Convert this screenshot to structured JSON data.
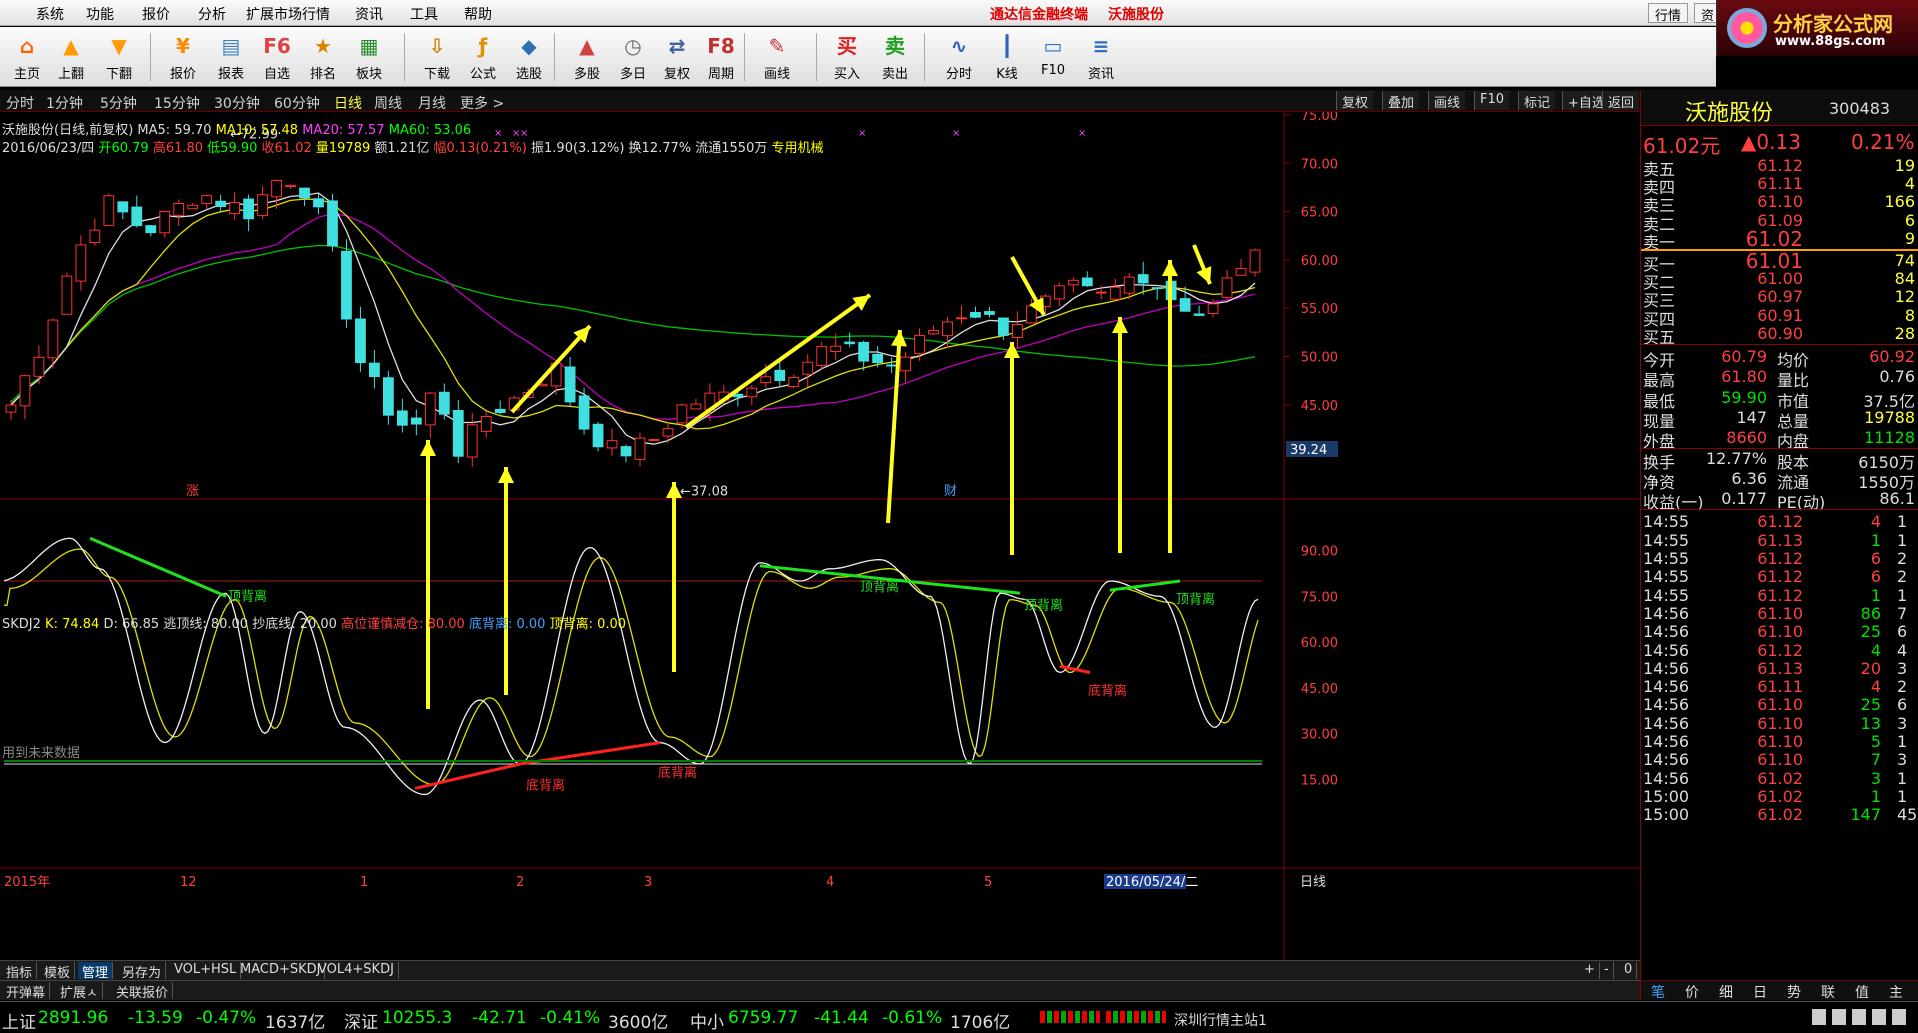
{
  "menu": {
    "items": [
      "系统",
      "功能",
      "报价",
      "分析",
      "扩展市场行情",
      "资讯",
      "工具",
      "帮助"
    ],
    "center_title": "通达信金融终端",
    "center_stock": "沃施股份",
    "right_btns": [
      "行情",
      "资"
    ]
  },
  "logo": {
    "line1": "分析家公式网",
    "line2": "www.88gs.com"
  },
  "toolbar": [
    {
      "label": "主页",
      "icon": "home-icon",
      "color": "#ff6000",
      "glyph": "⌂"
    },
    {
      "label": "上翻",
      "icon": "arrow-up-icon",
      "color": "#ff9a00",
      "glyph": "▲"
    },
    {
      "label": "下翻",
      "icon": "arrow-down-icon",
      "color": "#ff9a00",
      "glyph": "▼"
    },
    {
      "label": "报价",
      "icon": "quote-icon",
      "color": "#ff8800",
      "glyph": "¥"
    },
    {
      "label": "报表",
      "icon": "report-icon",
      "color": "#4080c0",
      "glyph": "▤"
    },
    {
      "label": "自选",
      "icon": "watchlist-icon",
      "color": "#e04040",
      "glyph": "F6"
    },
    {
      "label": "排名",
      "icon": "rank-icon",
      "color": "#e08000",
      "glyph": "★"
    },
    {
      "label": "板块",
      "icon": "sector-icon",
      "color": "#2a8a2a",
      "glyph": "▦"
    },
    {
      "label": "下载",
      "icon": "download-icon",
      "color": "#d08000",
      "glyph": "⇩"
    },
    {
      "label": "公式",
      "icon": "formula-icon",
      "color": "#e09000",
      "glyph": "ƒ"
    },
    {
      "label": "选股",
      "icon": "stock-pick-icon",
      "color": "#3070b0",
      "glyph": "◆"
    },
    {
      "label": "多股",
      "icon": "multi-stock-icon",
      "color": "#d04040",
      "glyph": "▲"
    },
    {
      "label": "多日",
      "icon": "multi-day-icon",
      "color": "#666666",
      "glyph": "◷"
    },
    {
      "label": "复权",
      "icon": "restore-icon",
      "color": "#4060a0",
      "glyph": "⇄"
    },
    {
      "label": "周期",
      "icon": "period-icon",
      "color": "#c03030",
      "glyph": "F8"
    },
    {
      "label": "画线",
      "icon": "draw-line-icon",
      "color": "#c03030",
      "glyph": "✎"
    },
    {
      "label": "买入",
      "icon": "buy-icon",
      "color": "#e02020",
      "glyph": "买"
    },
    {
      "label": "卖出",
      "icon": "sell-icon",
      "color": "#20a020",
      "glyph": "卖"
    },
    {
      "label": "分时",
      "icon": "intraday-icon",
      "color": "#3060c0",
      "glyph": "∿"
    },
    {
      "label": "K线",
      "icon": "kline-icon",
      "color": "#3060c0",
      "glyph": "┃"
    },
    {
      "label": "F10",
      "icon": "f10-icon",
      "color": "#3070c0",
      "glyph": "▭"
    },
    {
      "label": "资讯",
      "icon": "news-icon",
      "color": "#3070c0",
      "glyph": "≡"
    }
  ],
  "periods": [
    "分时",
    "1分钟",
    "5分钟",
    "15分钟",
    "30分钟",
    "60分钟",
    "日线",
    "周线",
    "月线",
    "更多 >"
  ],
  "active_period": "日线",
  "chart_right_btns": [
    "复权",
    "叠加",
    "画线",
    "F10",
    "标记",
    "+自选",
    "返回"
  ],
  "main_chart": {
    "stock_label": "沃施股份(日线,前复权)",
    "ma5": "MA5: 59.70",
    "ma10": "MA10: 57.48",
    "ma20": "MA20: 57.57",
    "ma60": "MA60: 53.06",
    "date": "2016/06/23/四",
    "open": "开60.79",
    "high": "高61.80",
    "low": "低59.90",
    "close": "收61.02",
    "vol": "量19789",
    "amount": "额1.21亿",
    "change": "幅0.13(0.21%)",
    "amp": "振1.90(3.12%)",
    "turnover": "换12.77%",
    "float": "流通1550万",
    "industry": "专用机械",
    "high_mark": "72.99",
    "low_mark": "37.08",
    "y_ticks": [
      "75.00",
      "70.00",
      "65.00",
      "60.00",
      "55.00",
      "50.00",
      "45.00"
    ],
    "cursor_value": "39.24",
    "zhang_mark": "涨",
    "cai_mark": "财"
  },
  "kdj": {
    "name": "SKDJ2",
    "k": "K: 74.84",
    "d": "D: 66.85",
    "escape": "逃顶线: 80.00",
    "bottom": "抄底线: 20.00",
    "reduce": "高位谨慎减仓: 80.00",
    "bottom_div": "底背离: 0.00",
    "top_div": "顶背离: 0.00",
    "y_ticks": [
      "90.00",
      "75.00",
      "60.00",
      "45.00",
      "30.00",
      "15.00"
    ],
    "labels_top": [
      "顶背离",
      "顶背离",
      "顶背离",
      "顶背离"
    ],
    "labels_bottom": [
      "底背离",
      "底背离",
      "底背离"
    ],
    "footer": "用到未来数据"
  },
  "x_axis": {
    "labels": [
      "2015年",
      "12",
      "1",
      "2",
      "3",
      "4",
      "5"
    ],
    "cursor_date": "2016/05/24/二",
    "right_label": "日线"
  },
  "chart_data": {
    "type": "candlestick",
    "x": "2015-11 to 2016-06-23 daily",
    "ylim": [
      37.08,
      75
    ],
    "annotated_high": 72.99,
    "annotated_low": 37.08,
    "last": {
      "open": 60.79,
      "high": 61.8,
      "low": 59.9,
      "close": 61.02
    },
    "ma": {
      "MA5": 59.7,
      "MA10": 57.48,
      "MA20": 57.57,
      "MA60": 53.06
    },
    "kdj_last": {
      "K": 74.84,
      "D": 66.85
    },
    "kdj_levels": [
      80,
      20
    ]
  },
  "bottom_tabs": [
    "指标",
    "模板",
    "管理",
    "另存为",
    "VOL+HSL",
    "MACD+SKDJ",
    "VOL4+SKDJ"
  ],
  "bottom_tabs2": [
    "开弹幕",
    "扩展ㅅ",
    "关联报价"
  ],
  "bottom_ctrl": [
    "+",
    "-",
    "0"
  ],
  "panel": {
    "name": "沃施股份",
    "code": "300483",
    "price": "61.02元",
    "change": "▲0.13",
    "pct": "0.21%",
    "asks": [
      {
        "l": "卖五",
        "p": "61.12",
        "v": "19"
      },
      {
        "l": "卖四",
        "p": "61.11",
        "v": "4"
      },
      {
        "l": "卖三",
        "p": "61.10",
        "v": "166"
      },
      {
        "l": "卖二",
        "p": "61.09",
        "v": "6"
      },
      {
        "l": "卖一",
        "p": "61.02",
        "v": "9"
      }
    ],
    "bids": [
      {
        "l": "买一",
        "p": "61.01",
        "v": "74"
      },
      {
        "l": "买二",
        "p": "61.00",
        "v": "84"
      },
      {
        "l": "买三",
        "p": "60.97",
        "v": "12"
      },
      {
        "l": "买四",
        "p": "60.91",
        "v": "8"
      },
      {
        "l": "买五",
        "p": "60.90",
        "v": "28"
      }
    ],
    "stats": [
      {
        "a": "今开",
        "b": "60.79",
        "c": "均价",
        "d": "60.92"
      },
      {
        "a": "最高",
        "b": "61.80",
        "c": "量比",
        "d": "0.76"
      },
      {
        "a": "最低",
        "b": "59.90",
        "c": "市值",
        "d": "37.5亿"
      },
      {
        "a": "现量",
        "b": "147",
        "c": "总量",
        "d": "19788"
      },
      {
        "a": "外盘",
        "b": "8660",
        "c": "内盘",
        "d": "11128"
      },
      {
        "a": "换手",
        "b": "12.77%",
        "c": "股本",
        "d": "6150万"
      },
      {
        "a": "净资",
        "b": "6.36",
        "c": "流通",
        "d": "1550万"
      },
      {
        "a": "收益(一)",
        "b": "0.177",
        "c": "PE(动)",
        "d": "86.1"
      }
    ],
    "ticks": [
      {
        "t": "14:55",
        "p": "61.12",
        "v": "4",
        "e": "1"
      },
      {
        "t": "14:55",
        "p": "61.13",
        "v": "1",
        "e": "1"
      },
      {
        "t": "14:55",
        "p": "61.12",
        "v": "6",
        "e": "2"
      },
      {
        "t": "14:55",
        "p": "61.12",
        "v": "6",
        "e": "2"
      },
      {
        "t": "14:55",
        "p": "61.12",
        "v": "1",
        "e": "1"
      },
      {
        "t": "14:56",
        "p": "61.10",
        "v": "86",
        "e": "7"
      },
      {
        "t": "14:56",
        "p": "61.10",
        "v": "25",
        "e": "6"
      },
      {
        "t": "14:56",
        "p": "61.12",
        "v": "4",
        "e": "4"
      },
      {
        "t": "14:56",
        "p": "61.13",
        "v": "20",
        "e": "3"
      },
      {
        "t": "14:56",
        "p": "61.11",
        "v": "4",
        "e": "2"
      },
      {
        "t": "14:56",
        "p": "61.10",
        "v": "25",
        "e": "6"
      },
      {
        "t": "14:56",
        "p": "61.10",
        "v": "13",
        "e": "3"
      },
      {
        "t": "14:56",
        "p": "61.10",
        "v": "5",
        "e": "1"
      },
      {
        "t": "14:56",
        "p": "61.10",
        "v": "7",
        "e": "3"
      },
      {
        "t": "14:56",
        "p": "61.02",
        "v": "3",
        "e": "1"
      },
      {
        "t": "15:00",
        "p": "61.02",
        "v": "1",
        "e": "1"
      },
      {
        "t": "15:00",
        "p": "61.02",
        "v": "147",
        "e": "45"
      }
    ],
    "tabs": [
      "笔",
      "价",
      "细",
      "日",
      "势",
      "联",
      "值",
      "主"
    ]
  },
  "status": {
    "sh_name": "上证",
    "sh_val": "2891.96",
    "sh_chg": "-13.59",
    "sh_pct": "-0.47%",
    "sh_amt": "1637亿",
    "sz_name": "深证",
    "sz_val": "10255.3",
    "sz_chg": "-42.71",
    "sz_pct": "-0.41%",
    "sz_amt": "3600亿",
    "zx_name": "中小",
    "zx_val": "6759.77",
    "zx_chg": "-41.44",
    "zx_pct": "-0.61%",
    "zx_amt": "1706亿",
    "server": "深圳行情主站1"
  }
}
